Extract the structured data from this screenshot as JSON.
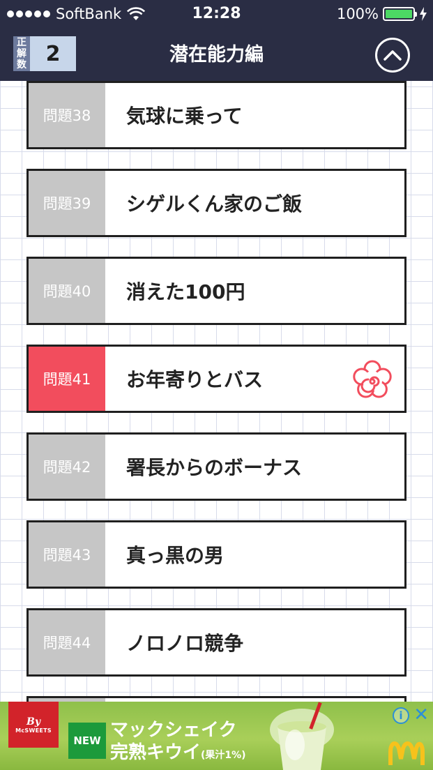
{
  "status_bar": {
    "carrier": "SoftBank",
    "time": "12:28",
    "battery": "100%"
  },
  "nav": {
    "score_label": [
      "正",
      "解",
      "数"
    ],
    "score_value": "2",
    "title": "潜在能力編"
  },
  "problems": [
    {
      "number": "問題38",
      "title": "気球に乗って",
      "solved": false
    },
    {
      "number": "問題39",
      "title": "シゲルくん家のご飯",
      "solved": false
    },
    {
      "number": "問題40",
      "title": "消えた100円",
      "solved": false
    },
    {
      "number": "問題41",
      "title": "お年寄りとバス",
      "solved": true
    },
    {
      "number": "問題42",
      "title": "署長からのボーナス",
      "solved": false
    },
    {
      "number": "問題43",
      "title": "真っ黒の男",
      "solved": false
    },
    {
      "number": "問題44",
      "title": "ノロノロ競争",
      "solved": false
    }
  ],
  "ad": {
    "brand_by": "By",
    "brand_name": "McSWEETS",
    "badge": "NEW",
    "line1": "マックシェイク",
    "line2": "完熟キウイ",
    "note": "(果汁1%)",
    "info": "i",
    "close": "✕"
  },
  "colors": {
    "header_bg": "#2a2d44",
    "number_cell": "#c6c6c6",
    "solved_cell": "#f24d5d",
    "score_bg": "#c7d6ea",
    "grid_line": "#d7dbea"
  }
}
